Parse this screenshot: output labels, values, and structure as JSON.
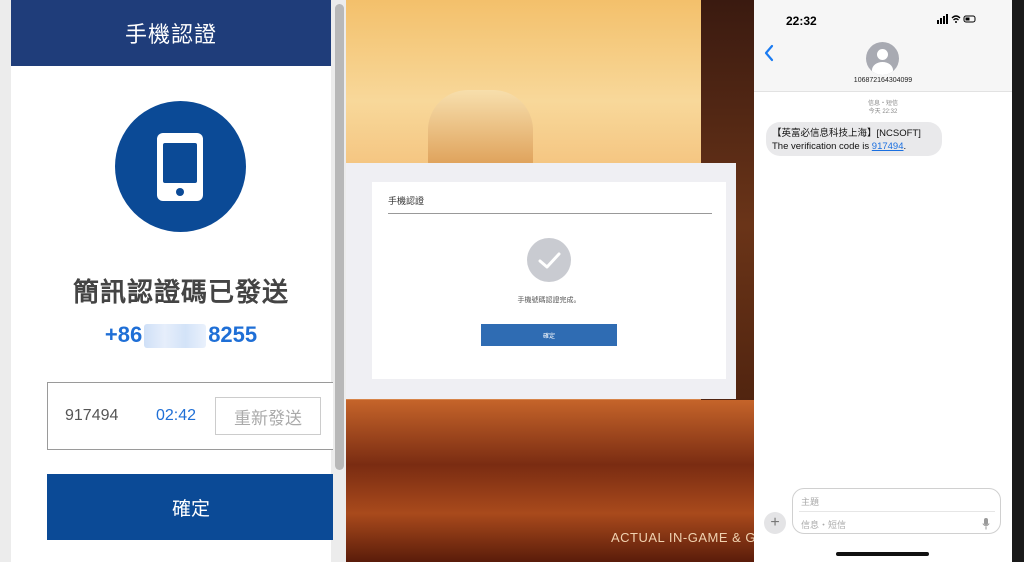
{
  "left_panel": {
    "header_title": "手機認證",
    "sent_title": "簡訊認證碼已發送",
    "phone_prefix": "+86",
    "phone_suffix": "8255",
    "code_value": "917494",
    "timer": "02:42",
    "resend_label": "重新發送",
    "confirm_label": "確定",
    "colors": {
      "header": "#1f3d7a",
      "accent": "#0b4a96",
      "link": "#1f6fd6"
    },
    "icon": "smartphone-icon"
  },
  "game_dialog": {
    "title": "手機認證",
    "message": "手機號碼認證完成。",
    "confirm_label": "確定",
    "icon": "check-circle-icon"
  },
  "background": {
    "caption": "ACTUAL IN-GAME & GAM"
  },
  "phone": {
    "status_time": "22:32",
    "status_icons": "signal wifi battery",
    "contact_number": "106872164304099",
    "meta_line1": "信息・短信",
    "meta_line2": "今天 22:32",
    "message_prefix": "【英富必信息科技上海】[NCSOFT] The verification code is ",
    "message_code": "917494",
    "message_suffix": ".",
    "compose_subject_placeholder": "主題",
    "compose_message_placeholder": "信息・短信",
    "plus_label": "+",
    "icons": [
      "chevron-left-icon",
      "contact-avatar-icon",
      "microphone-icon"
    ]
  }
}
